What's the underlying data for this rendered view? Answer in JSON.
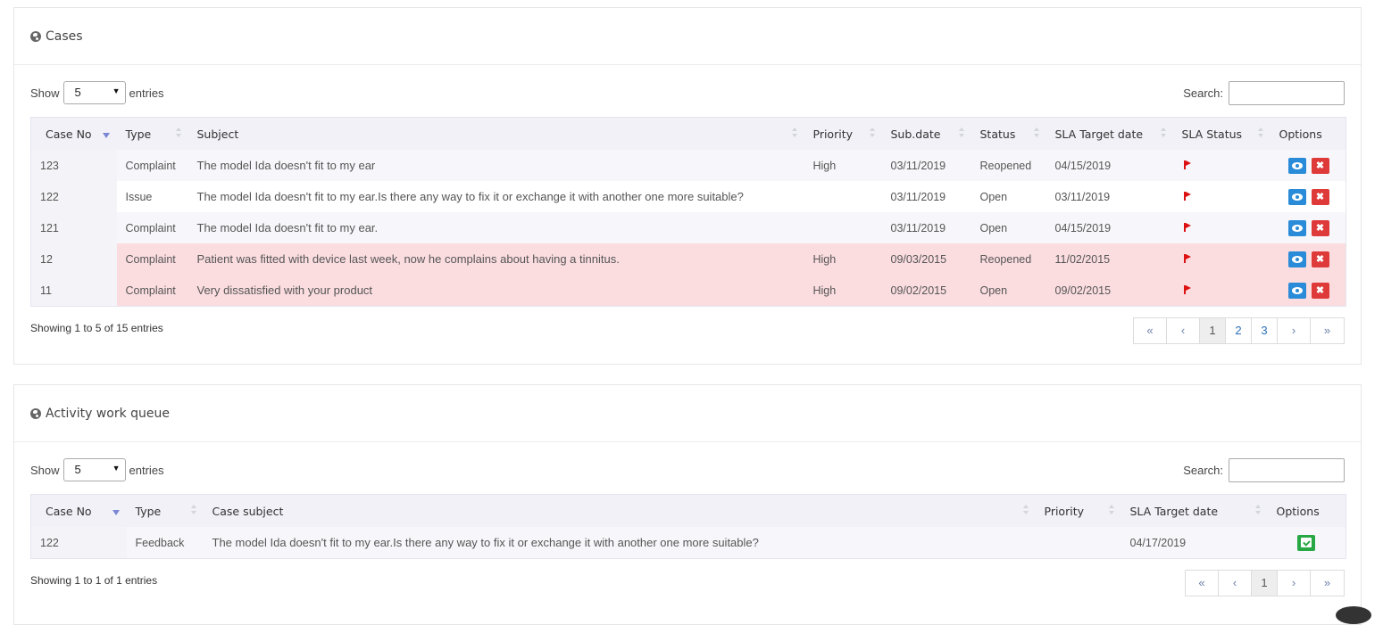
{
  "cases": {
    "title": "Cases",
    "show_label": "Show",
    "entries_label": "entries",
    "page_size": "5",
    "search_label": "Search:",
    "columns": [
      "Case No",
      "Type",
      "Subject",
      "Priority",
      "Sub.date",
      "Status",
      "SLA Target date",
      "SLA Status",
      "Options"
    ],
    "rows": [
      {
        "case_no": "123",
        "type": "Complaint",
        "subject": "The model Ida doesn't fit to my ear",
        "priority": "High",
        "sub_date": "03/11/2019",
        "status": "Reopened",
        "sla_target": "04/15/2019",
        "highlight": false
      },
      {
        "case_no": "122",
        "type": "Issue",
        "subject": "The model Ida doesn't fit to my ear.Is there any way to fix it or exchange it with another one more suitable?",
        "priority": "",
        "sub_date": "03/11/2019",
        "status": "Open",
        "sla_target": "03/11/2019",
        "highlight": false
      },
      {
        "case_no": "121",
        "type": "Complaint",
        "subject": "The model Ida doesn't fit to my ear.",
        "priority": "",
        "sub_date": "03/11/2019",
        "status": "Open",
        "sla_target": "04/15/2019",
        "highlight": false
      },
      {
        "case_no": "12",
        "type": "Complaint",
        "subject": "Patient was fitted with device last week, now he complains about having a tinnitus.",
        "priority": "High",
        "sub_date": "09/03/2015",
        "status": "Reopened",
        "sla_target": "11/02/2015",
        "highlight": true
      },
      {
        "case_no": "11",
        "type": "Complaint",
        "subject": "Very dissatisfied with your product",
        "priority": "High",
        "sub_date": "09/02/2015",
        "status": "Open",
        "sla_target": "09/02/2015",
        "highlight": true
      }
    ],
    "info": "Showing 1 to 5 of 15 entries",
    "pager": {
      "first": "«",
      "prev": "‹",
      "pages": [
        "1",
        "2",
        "3"
      ],
      "active_page": "1",
      "next": "›",
      "last": "»"
    },
    "delete_glyph": "✖"
  },
  "queue": {
    "title": "Activity work queue",
    "show_label": "Show",
    "entries_label": "entries",
    "page_size": "5",
    "search_label": "Search:",
    "columns": [
      "Case No",
      "Type",
      "Case subject",
      "Priority",
      "SLA Target date",
      "Options"
    ],
    "rows": [
      {
        "case_no": "122",
        "type": "Feedback",
        "subject": "The model Ida doesn't fit to my ear.Is there any way to fix it or exchange it with another one more suitable?",
        "priority": "",
        "sla_target": "04/17/2019"
      }
    ],
    "info": "Showing 1 to 1 of 1 entries",
    "pager": {
      "first": "«",
      "prev": "‹",
      "pages": [
        "1"
      ],
      "active_page": "1",
      "next": "›",
      "last": "»"
    }
  },
  "colors": {
    "highlight_row": "#fbdde0",
    "link": "#2b2bd6",
    "view_button": "#2a8bd8",
    "delete_button": "#de3a3a",
    "assign_button": "#28a745",
    "sla_flag": "#dd1111"
  },
  "icons": {
    "panel": "globe-icon",
    "view": "eye-icon",
    "delete": "close-icon",
    "assign": "check-square-icon",
    "sla": "flag-icon"
  }
}
